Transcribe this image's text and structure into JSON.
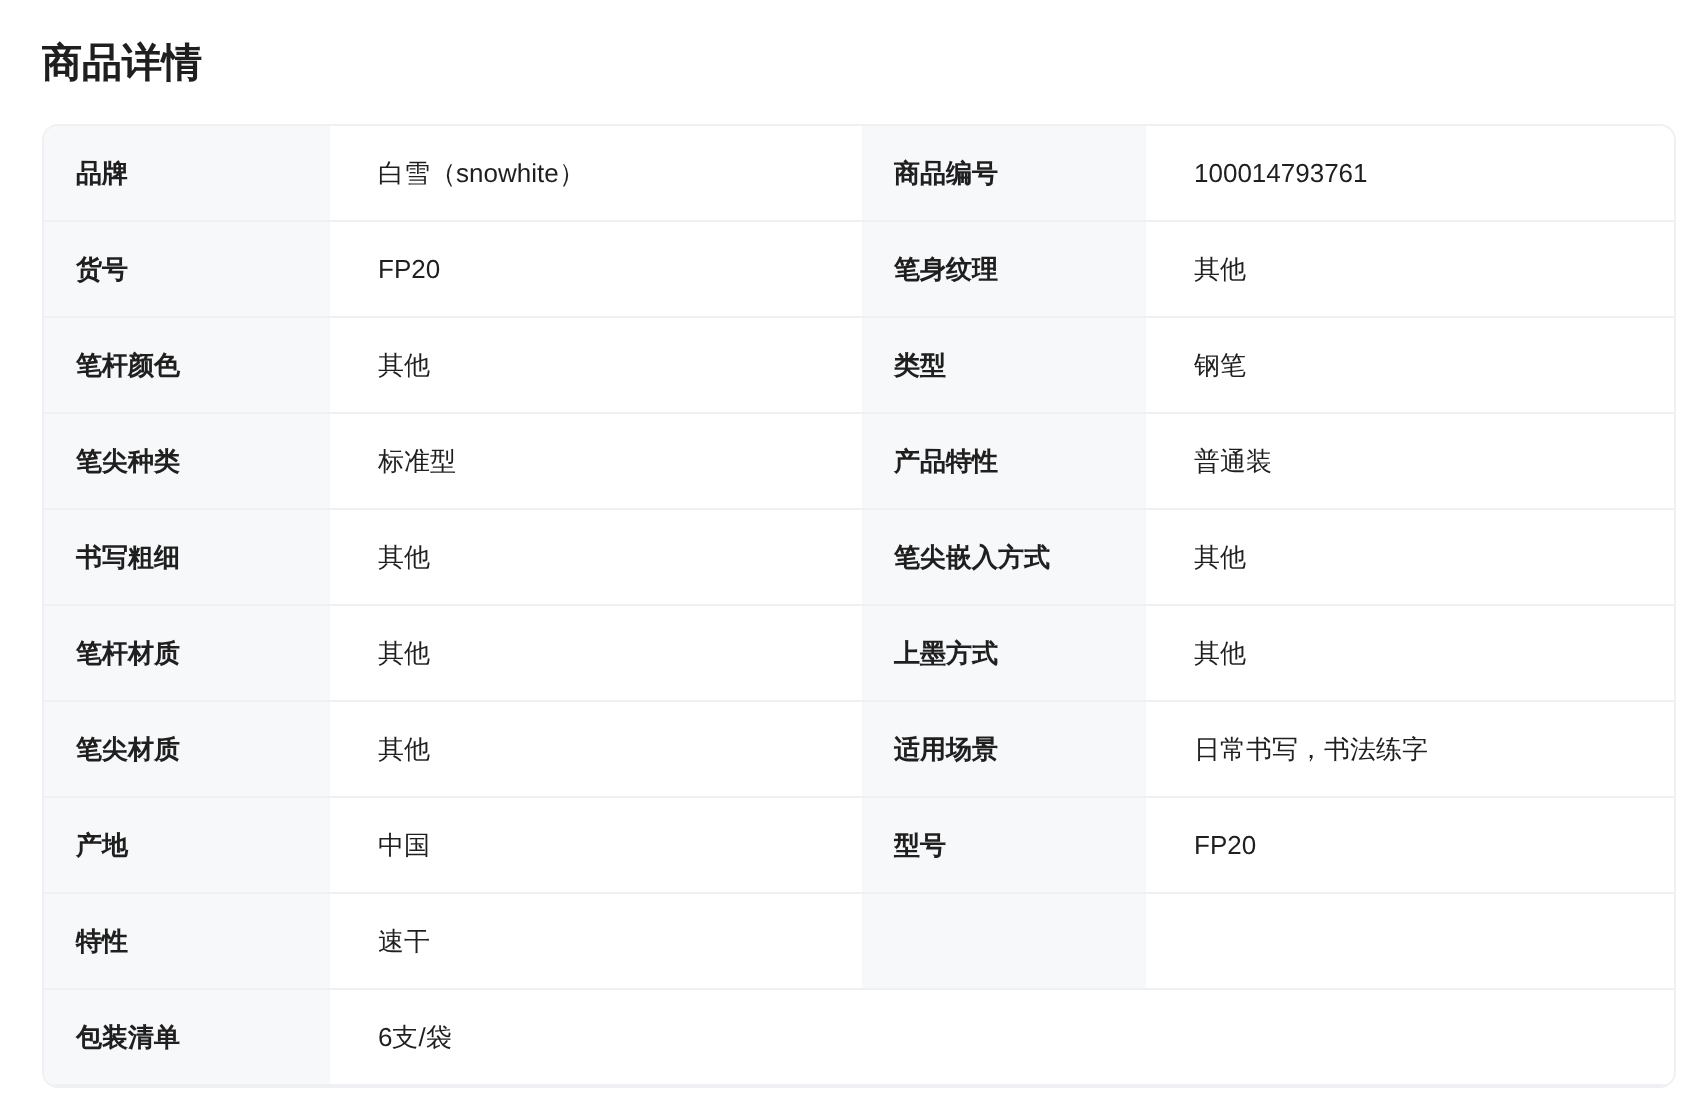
{
  "title": "商品详情",
  "rows": [
    {
      "kind": "split",
      "pairs": [
        {
          "label": "品牌",
          "value": "白雪（snowhite）"
        },
        {
          "label": "商品编号",
          "value": "100014793761"
        }
      ]
    },
    {
      "kind": "split",
      "pairs": [
        {
          "label": "货号",
          "value": "FP20"
        },
        {
          "label": "笔身纹理",
          "value": "其他"
        }
      ]
    },
    {
      "kind": "split",
      "pairs": [
        {
          "label": "笔杆颜色",
          "value": "其他"
        },
        {
          "label": "类型",
          "value": "钢笔"
        }
      ]
    },
    {
      "kind": "split",
      "pairs": [
        {
          "label": "笔尖种类",
          "value": "标准型"
        },
        {
          "label": "产品特性",
          "value": "普通装"
        }
      ]
    },
    {
      "kind": "split",
      "pairs": [
        {
          "label": "书写粗细",
          "value": "其他"
        },
        {
          "label": "笔尖嵌入方式",
          "value": "其他"
        }
      ]
    },
    {
      "kind": "split",
      "pairs": [
        {
          "label": "笔杆材质",
          "value": "其他"
        },
        {
          "label": "上墨方式",
          "value": "其他"
        }
      ]
    },
    {
      "kind": "split",
      "pairs": [
        {
          "label": "笔尖材质",
          "value": "其他"
        },
        {
          "label": "适用场景",
          "value": "日常书写，书法练字"
        }
      ]
    },
    {
      "kind": "split",
      "pairs": [
        {
          "label": "产地",
          "value": "中国"
        },
        {
          "label": "型号",
          "value": "FP20"
        }
      ]
    },
    {
      "kind": "split",
      "pairs": [
        {
          "label": "特性",
          "value": "速干"
        }
      ]
    },
    {
      "kind": "wide",
      "pairs": [
        {
          "label": "包装清单",
          "value": "6支/袋"
        }
      ]
    }
  ]
}
